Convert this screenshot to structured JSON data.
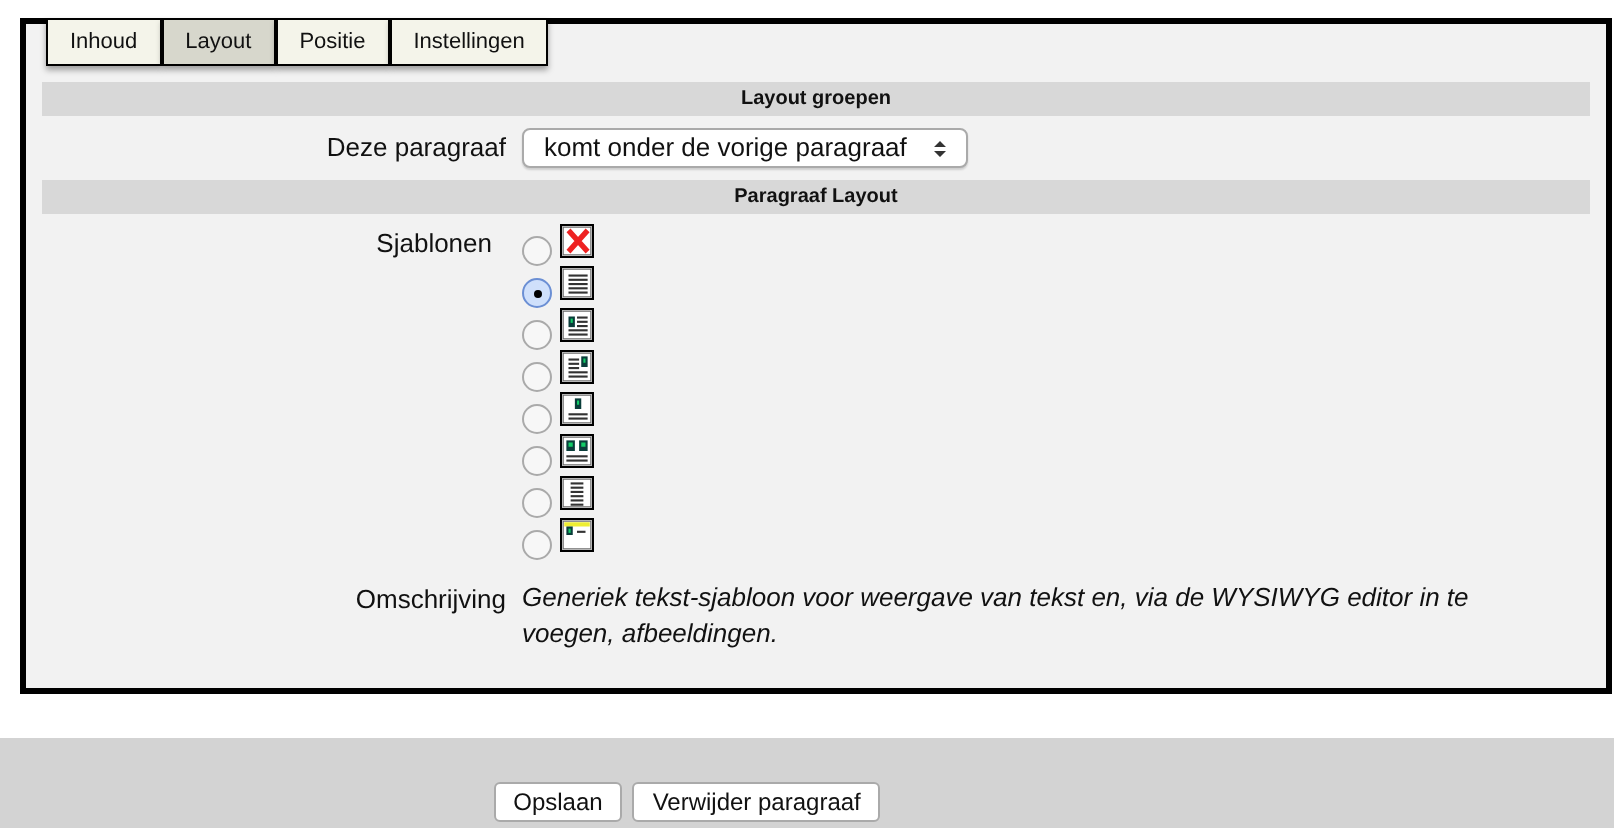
{
  "tabs": [
    {
      "label": "Inhoud",
      "selected": false
    },
    {
      "label": "Layout",
      "selected": true
    },
    {
      "label": "Positie",
      "selected": false
    },
    {
      "label": "Instellingen",
      "selected": false
    }
  ],
  "sections": [
    {
      "title": "Layout groepen"
    },
    {
      "title": "Paragraaf Layout"
    }
  ],
  "placement": {
    "label": "Deze paragraaf",
    "value": "komt onder de vorige paragraaf"
  },
  "templates": {
    "label": "Sjablonen",
    "options": [
      {
        "kind": "none",
        "selected": false
      },
      {
        "kind": "text",
        "selected": true
      },
      {
        "kind": "image-left",
        "selected": false
      },
      {
        "kind": "image-right",
        "selected": false
      },
      {
        "kind": "image-top",
        "selected": false
      },
      {
        "kind": "two-images",
        "selected": false
      },
      {
        "kind": "narrow-text",
        "selected": false
      },
      {
        "kind": "header",
        "selected": false
      }
    ]
  },
  "description": {
    "label": "Omschrijving",
    "text": "Generiek tekst-sjabloon voor weergave van tekst en, via de WYSIWYG editor in te voegen, afbeeldingen."
  },
  "buttons": [
    "Opslaan",
    "Verwijder paragraaf"
  ]
}
